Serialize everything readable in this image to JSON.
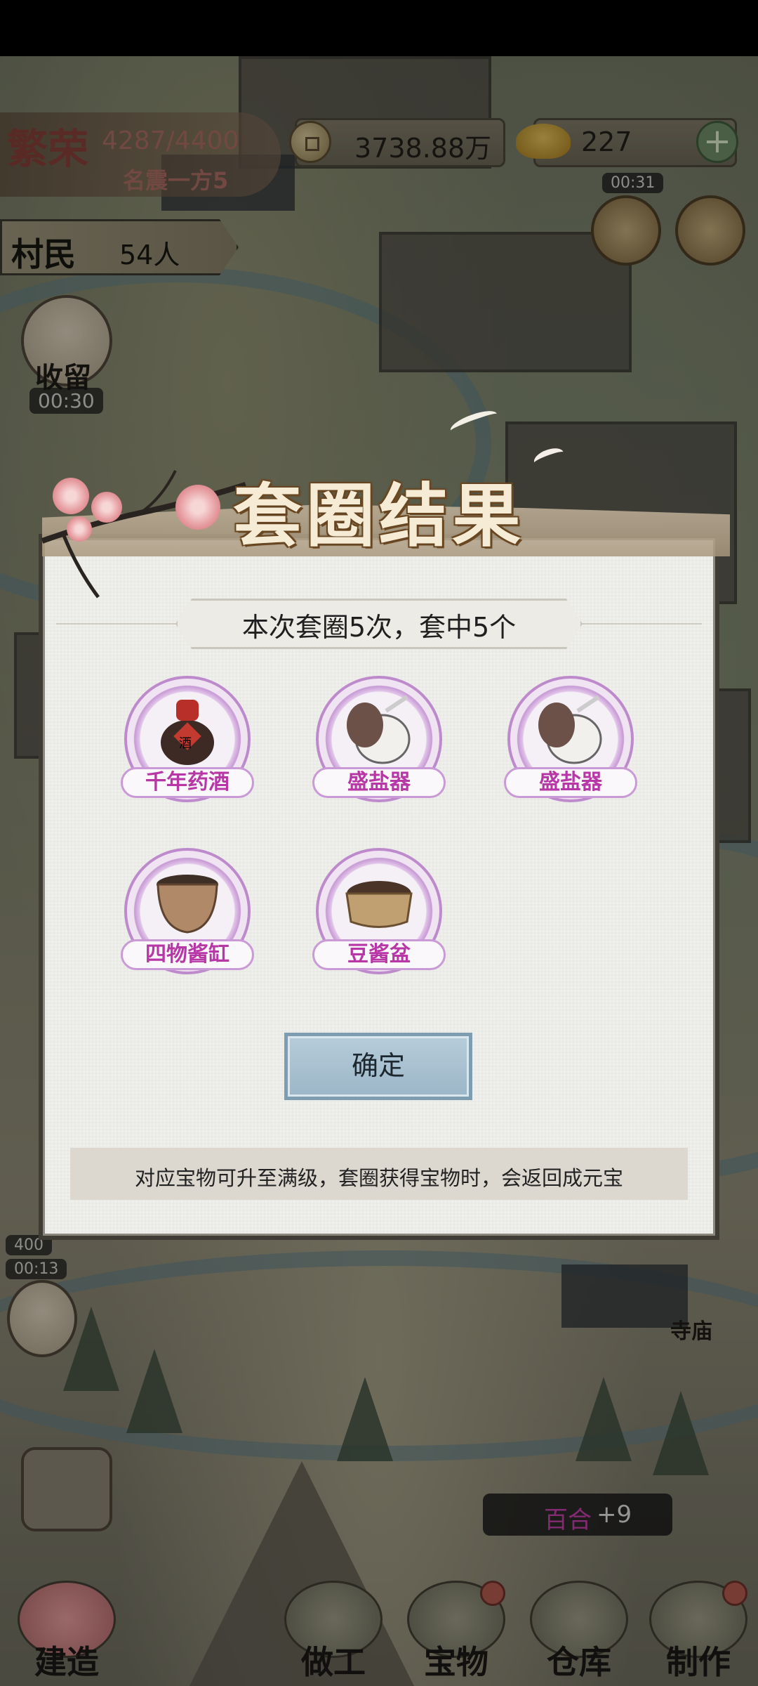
{
  "hud": {
    "fame_title": "繁荣",
    "fame_value": "4287/4400",
    "fame_rank": "名震一方5",
    "coins": "3738.88万",
    "gold": "227",
    "plus": "+",
    "villager_label": "村民",
    "villager_count": "54人",
    "timer_top": "00:31"
  },
  "side": {
    "shelter_label": "收留",
    "shelter_timer": "00:30",
    "count_chip": "400",
    "lower_timer": "00:13",
    "temple_label": "寺庙"
  },
  "modal": {
    "title": "套圈结果",
    "summary": "本次套圈5次，套中5个",
    "prizes": [
      {
        "name": "千年药酒",
        "icon": "medicine-wine-jar-icon"
      },
      {
        "name": "盛盐器",
        "icon": "salt-container-icon"
      },
      {
        "name": "盛盐器",
        "icon": "salt-container-icon"
      },
      {
        "name": "四物酱缸",
        "icon": "sauce-vat-icon"
      },
      {
        "name": "豆酱盆",
        "icon": "bean-paste-basin-icon"
      }
    ],
    "wine_char": "酒",
    "confirm": "确定",
    "note": "对应宝物可升至满级，套圈获得宝物时，会返回成元宝"
  },
  "toast": {
    "name": "百合",
    "amount": "+9"
  },
  "nav": [
    {
      "label": "建造"
    },
    {
      "label": "做工"
    },
    {
      "label": "宝物"
    },
    {
      "label": "仓库"
    },
    {
      "label": "制作"
    }
  ],
  "colors": {
    "prize_label_text": "#b637a5",
    "confirm_bg": "#a9c2d2",
    "title_text": "#f6ecd6"
  }
}
